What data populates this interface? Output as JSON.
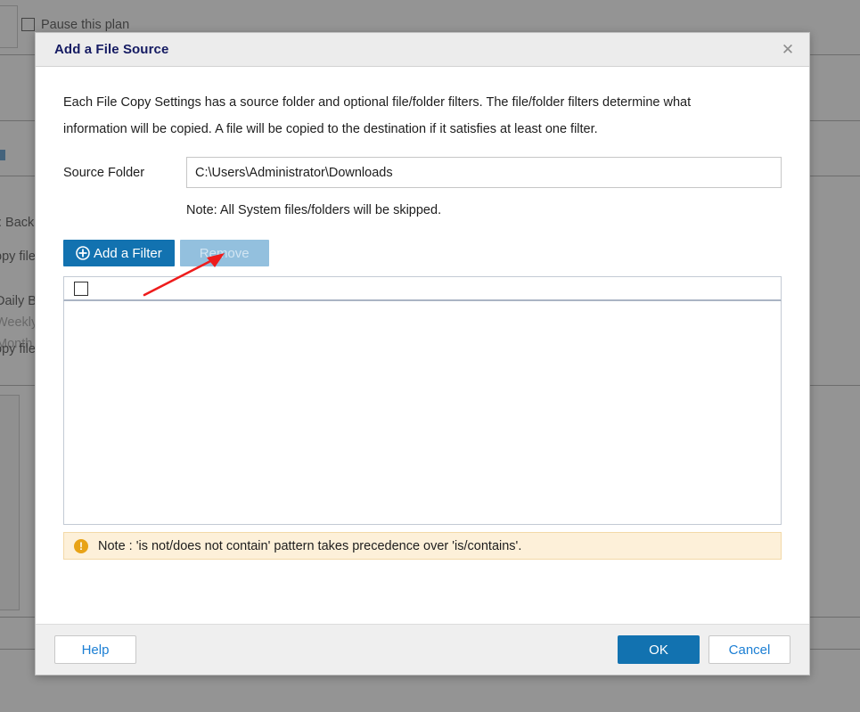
{
  "background": {
    "pause_checkbox_label": "Pause this plan",
    "fragments": [
      {
        "text": ": Back"
      },
      {
        "text": "opy file"
      },
      {
        "text": "Daily B"
      },
      {
        "text": "Weekly"
      },
      {
        "text": "Month"
      },
      {
        "text": "opy file"
      }
    ]
  },
  "dialog": {
    "title": "Add a File Source",
    "close_icon": "close-icon",
    "close_glyph": "✕",
    "intro": "Each File Copy Settings has a source folder and optional file/folder filters. The file/folder filters determine what information will be copied. A file will be copied to the destination if it satisfies at least one filter.",
    "source_folder": {
      "label": "Source Folder",
      "value": "C:\\Users\\Administrator\\Downloads",
      "placeholder": "",
      "note": "Note: All System files/folders will be skipped."
    },
    "toolbar": {
      "add_filter_label": "Add a Filter",
      "add_filter_icon": "plus-circle-icon",
      "add_filter_glyph": "⊕",
      "remove_label": "Remove",
      "remove_enabled": false
    },
    "grid": {
      "select_all_checked": false,
      "rows": []
    },
    "warning": {
      "icon": "exclamation-circle-icon",
      "icon_glyph": "!",
      "text": "Note : 'is not/does not contain' pattern takes precedence over 'is/contains'."
    },
    "footer": {
      "help_label": "Help",
      "ok_label": "OK",
      "cancel_label": "Cancel"
    }
  },
  "annotation": {
    "arrow_color": "#ee1c1c",
    "arrow_name": "red-pointer-arrow"
  },
  "colors": {
    "accent_blue": "#1272b0",
    "link_blue": "#1c7fd4",
    "title_navy": "#151b62",
    "disabled_blue": "#93c0de",
    "warning_bg": "#fdf0d9",
    "warning_border": "#f3d9a8",
    "warning_icon": "#e8a317",
    "scrim": "rgba(83,83,83,0.62)"
  }
}
